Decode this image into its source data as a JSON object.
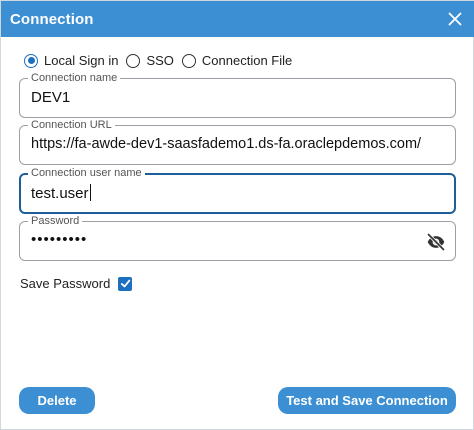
{
  "window": {
    "title": "Connection"
  },
  "connection_type": {
    "options": [
      {
        "label": "Local Sign in",
        "selected": true
      },
      {
        "label": "SSO",
        "selected": false
      },
      {
        "label": "Connection File",
        "selected": false
      }
    ]
  },
  "fields": {
    "connection_name": {
      "label": "Connection name",
      "value": "DEV1"
    },
    "connection_url": {
      "label": "Connection URL",
      "value": "https://fa-awde-dev1-saasfademo1.ds-fa.oraclepdemos.com/"
    },
    "user_name": {
      "label": "Connection user name",
      "value": "test.user"
    },
    "password": {
      "label": "Password",
      "value": "•••••••••"
    }
  },
  "save_password": {
    "label": "Save Password",
    "checked": true
  },
  "buttons": {
    "delete": "Delete",
    "test_and_save": "Test and Save Connection"
  },
  "colors": {
    "accent": "#3c8fd3",
    "focus_border": "#1f5f99",
    "radio_selected": "#1e6fbf"
  },
  "icons": {
    "close": "close-icon",
    "password_visibility": "eye-off-icon",
    "checkbox": "checkmark-icon"
  }
}
